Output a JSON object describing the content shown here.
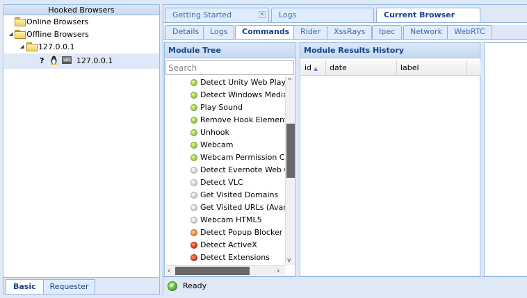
{
  "left_panel": {
    "title": "Hooked Browsers",
    "tree": {
      "online": "Online Browsers",
      "offline": "Offline Browsers",
      "host": "127.0.0.1",
      "browser_ip": "127.0.0.1",
      "help_glyph": "?"
    },
    "tabs": [
      "Basic",
      "Requester"
    ]
  },
  "top_tabs": [
    "Getting Started",
    "Logs",
    "Current Browser"
  ],
  "sub_tabs": [
    "Details",
    "Logs",
    "Commands",
    "Rider",
    "XssRays",
    "Ipec",
    "Network",
    "WebRTC"
  ],
  "module_tree": {
    "title": "Module Tree",
    "search_placeholder": "Search",
    "items": [
      {
        "label": "Detect Unity Web Player",
        "status": "green"
      },
      {
        "label": "Detect Windows Media Player",
        "status": "green"
      },
      {
        "label": "Play Sound",
        "status": "green"
      },
      {
        "label": "Remove Hook Element",
        "status": "green"
      },
      {
        "label": "Unhook",
        "status": "green"
      },
      {
        "label": "Webcam",
        "status": "green"
      },
      {
        "label": "Webcam Permission Check",
        "status": "green"
      },
      {
        "label": "Detect Evernote Web Clipper",
        "status": "grey"
      },
      {
        "label": "Detect VLC",
        "status": "grey"
      },
      {
        "label": "Get Visited Domains",
        "status": "grey"
      },
      {
        "label": "Get Visited URLs (Avant",
        "status": "grey"
      },
      {
        "label": "Webcam HTML5",
        "status": "grey"
      },
      {
        "label": "Detect Popup Blocker",
        "status": "orange"
      },
      {
        "label": "Detect ActiveX",
        "status": "red"
      },
      {
        "label": "Detect Extensions",
        "status": "red"
      }
    ]
  },
  "results": {
    "title": "Module Results History",
    "columns": [
      "id",
      "date",
      "label"
    ]
  },
  "status_bar": {
    "text": "Ready"
  },
  "colors": {
    "accent": "#15428b",
    "border": "#99bbe8",
    "panel_bg": "#dfe8f6"
  }
}
